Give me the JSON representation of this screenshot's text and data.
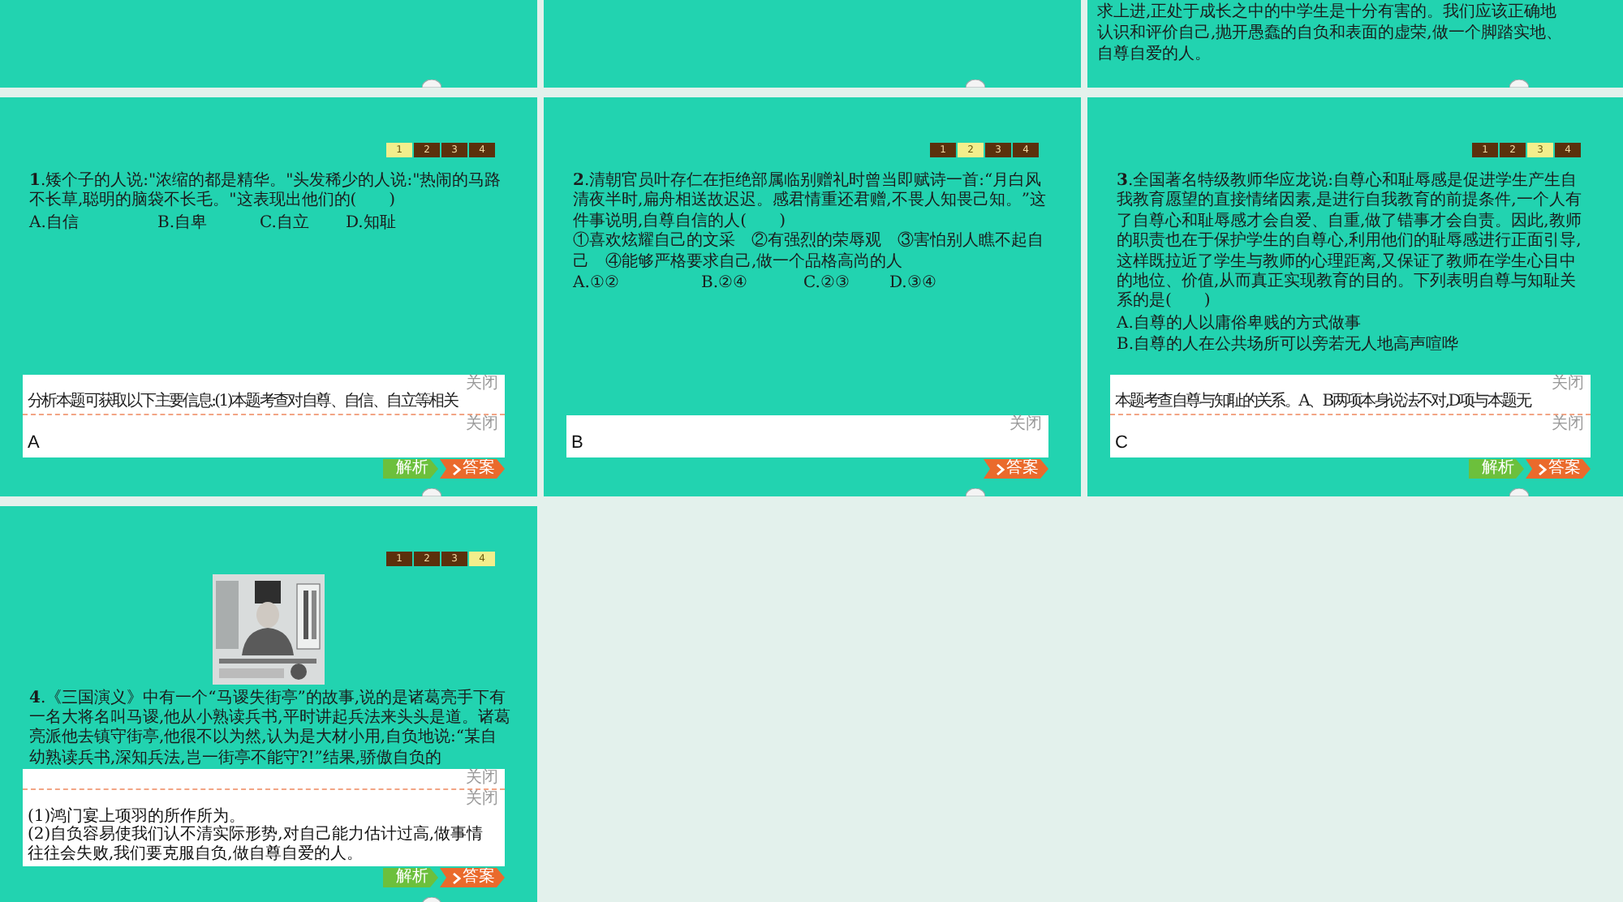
{
  "slides": [
    {
      "kind": "blank"
    },
    {
      "kind": "blank"
    },
    {
      "kind": "tail",
      "text": "求上进,正处于成长之中的中学生是十分有害的。我们应该正确地认识和评价自己,抛开愚蠢的自负和表面的虚荣,做一个脚踏实地、自尊自爱的人。"
    },
    {
      "kind": "question",
      "pages": [
        {
          "label": "1",
          "selected": true
        },
        {
          "label": "2",
          "selected": false
        },
        {
          "label": "3",
          "selected": false
        },
        {
          "label": "4",
          "selected": false
        }
      ],
      "question": "**1**.矮个子的人说:\"浓缩的都是精华。\"头发稀少的人说:\"热闹的马路不长草,聪明的脑袋不长毛。\"这表现出他们的(　　)",
      "options": [
        [
          "A.自信",
          "B.自卑",
          "C.自立",
          "D.知耻"
        ]
      ],
      "analysis": {
        "close": "关闭",
        "text": "分析本题可获取以下主要信息:(1)本题考查对自尊、自信、自立等相关"
      },
      "answer": {
        "close": "关闭",
        "kind": "letter",
        "text": [
          "A"
        ]
      },
      "buttons": [
        {
          "kind": "analysis",
          "label": "解析"
        },
        {
          "kind": "answer",
          "label": "答案"
        }
      ]
    },
    {
      "kind": "question",
      "pages": [
        {
          "label": "1",
          "selected": false
        },
        {
          "label": "2",
          "selected": true
        },
        {
          "label": "3",
          "selected": false
        },
        {
          "label": "4",
          "selected": false
        }
      ],
      "question": "**2**.清朝官员叶存仁在拒绝部属临别赠礼时曾当即赋诗一首:“月白风清夜半时,扁舟相送故迟迟。感君情重还君赠,不畏人知畏己知。”这件事说明,自尊自信的人(　　)",
      "statements": "①喜欢炫耀自己的文采　②有强烈的荣辱观　③害怕别人瞧不起自己　④能够严格要求自己,做一个品格高尚的人",
      "options": [
        [
          "A.①②",
          "B.②④",
          "C.②③",
          "D.③④"
        ]
      ],
      "answer": {
        "close": "关闭",
        "kind": "letter",
        "text": [
          "B"
        ]
      },
      "buttons": [
        {
          "kind": "answer",
          "label": "答案"
        }
      ]
    },
    {
      "kind": "question",
      "pages": [
        {
          "label": "1",
          "selected": false
        },
        {
          "label": "2",
          "selected": false
        },
        {
          "label": "3",
          "selected": true
        },
        {
          "label": "4",
          "selected": false
        }
      ],
      "question": "**3**.全国著名特级教师华应龙说:自尊心和耻辱感是促进学生产生自我教育愿望的直接情绪因素,是进行自我教育的前提条件,一个人有了自尊心和耻辱感才会自爱、自重,做了错事才会自责。因此,教师的职责也在于保护学生的自尊心,利用他们的耻辱感进行正面引导,这样既拉近了学生与教师的心理距离,又保证了教师在学生心目中的地位、价值,从而真正实现教育的目的。下列表明自尊与知耻关系的是(　　)",
      "options": [
        [
          "A.自尊的人以庸俗卑贱的方式做事"
        ],
        [
          "B.自尊的人在公共场所可以旁若无人地高声喧哗"
        ]
      ],
      "analysis": {
        "close": "关闭",
        "text": "本题考查自尊与知耻的关系。A、B两项本身说法不对,D项与本题无"
      },
      "answer": {
        "close": "关闭",
        "kind": "letter",
        "text": [
          "C"
        ]
      },
      "buttons": [
        {
          "kind": "analysis",
          "label": "解析"
        },
        {
          "kind": "answer",
          "label": "答案"
        }
      ]
    },
    {
      "kind": "question",
      "pages": [
        {
          "label": "1",
          "selected": false
        },
        {
          "label": "2",
          "selected": false
        },
        {
          "label": "3",
          "selected": false
        },
        {
          "label": "4",
          "selected": true
        }
      ],
      "question": "**4**.《三国演义》中有一个“马谡失街亭”的故事,说的是诸葛亮手下有一名大将名叫马谡,他从小熟读兵书,平时讲起兵法来头头是道。诸葛亮派他去镇守街亭,他很不以为然,认为是大材小用,自负地说:“某自幼熟读兵书,深知兵法,岂一街亭不能守?!”结果,骄傲自负的",
      "analysis": {
        "close": "关闭"
      },
      "answer": {
        "close": "关闭",
        "kind": "text",
        "text": [
          "(1)鸿门宴上项羽的所作所为。",
          "(2)自负容易使我们认不清实际形势,对自己能力估计过高,做事情往往会失败,我们要克服自负,做自尊自爱的人。"
        ]
      },
      "buttons": [
        {
          "kind": "analysis",
          "label": "解析"
        },
        {
          "kind": "answer",
          "label": "答案"
        }
      ]
    }
  ]
}
